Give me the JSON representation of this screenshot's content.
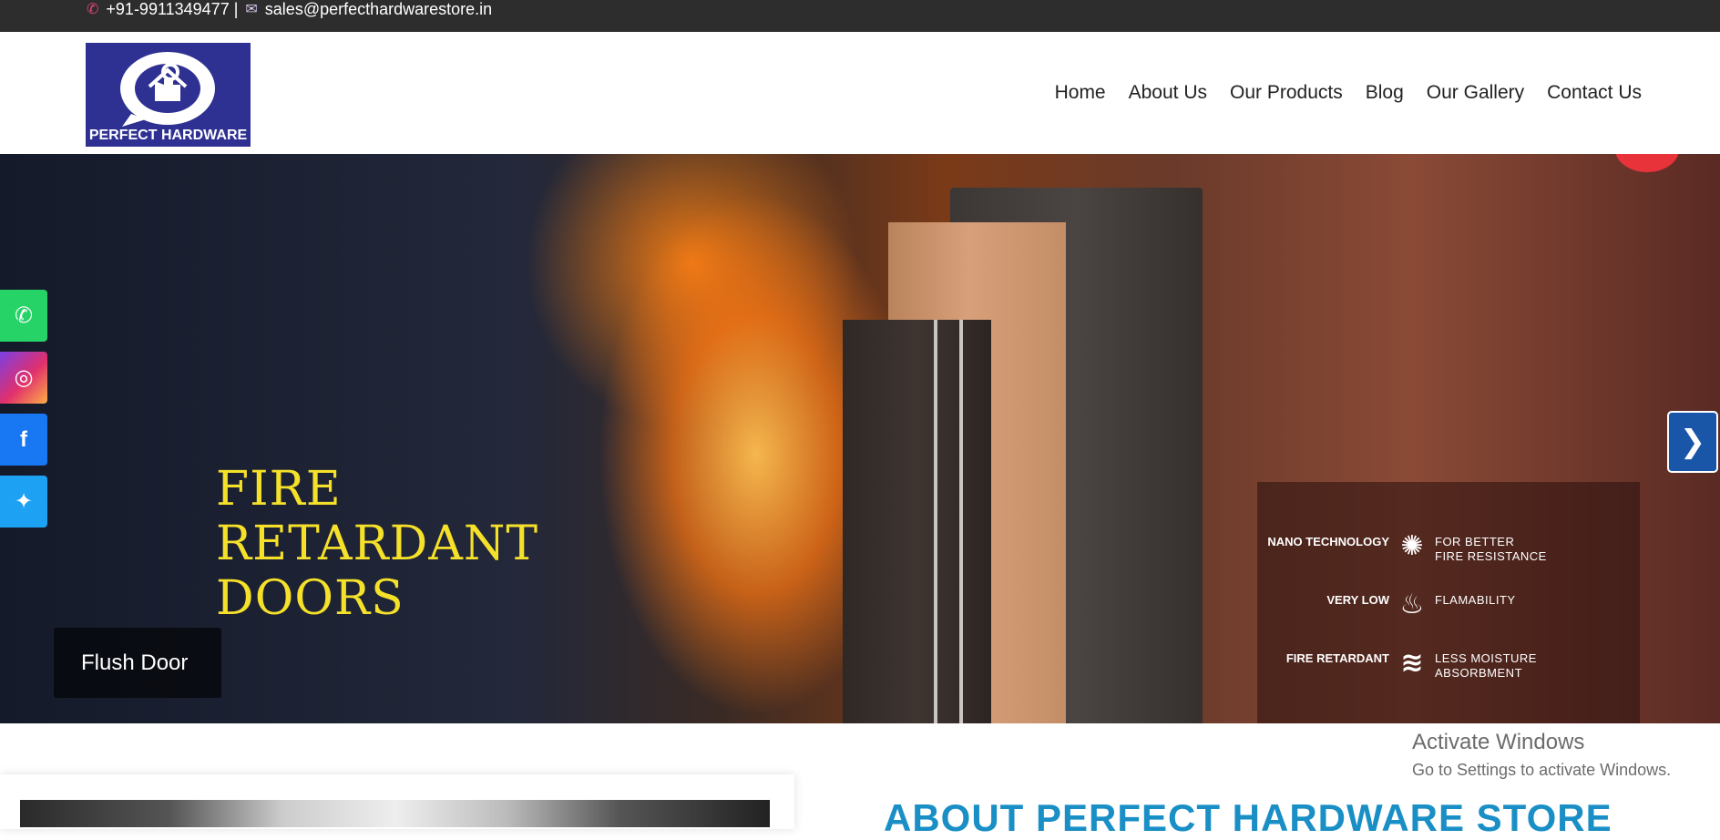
{
  "topbar": {
    "phone": "+91-9911349477 |",
    "email": "sales@perfecthardwarestore.in"
  },
  "logo": {
    "text": "PERFECT HARDWARE"
  },
  "nav": {
    "items": [
      {
        "label": "Home"
      },
      {
        "label": "About Us"
      },
      {
        "label": "Our Products"
      },
      {
        "label": "Blog"
      },
      {
        "label": "Our Gallery"
      },
      {
        "label": "Contact Us"
      }
    ]
  },
  "hero": {
    "title_lines": [
      "FIRE",
      "RETARDANT",
      "DOORS"
    ],
    "caption": "Flush Door",
    "features": [
      {
        "label": "NANO TECHNOLOGY",
        "icon": "nano-icon",
        "desc_lines": [
          "FOR BETTER",
          "FIRE RESISTANCE"
        ]
      },
      {
        "label": "VERY LOW",
        "icon": "flame-icon",
        "desc_lines": [
          "FLAMABILITY"
        ]
      },
      {
        "label": "FIRE RETARDANT",
        "icon": "layers-icon",
        "desc_lines": [
          "LESS MOISTURE",
          "ABSORBMENT"
        ]
      }
    ],
    "next_label": "❯"
  },
  "socials": [
    {
      "name": "whatsapp-icon",
      "glyph": "✆"
    },
    {
      "name": "instagram-icon",
      "glyph": "◎"
    },
    {
      "name": "facebook-icon",
      "glyph": "f"
    },
    {
      "name": "twitter-icon",
      "glyph": "✦"
    }
  ],
  "about": {
    "title": "ABOUT PERFECT HARDWARE STORE"
  },
  "windows": {
    "line1": "Activate Windows",
    "line2": "Go to Settings to activate Windows."
  },
  "colors": {
    "topbar_bg": "#2d2d2d",
    "logo_bg": "#2e3192",
    "title_yellow": "#f5e02a",
    "about_blue": "#1a8fc6",
    "next_btn": "#1956a8"
  }
}
